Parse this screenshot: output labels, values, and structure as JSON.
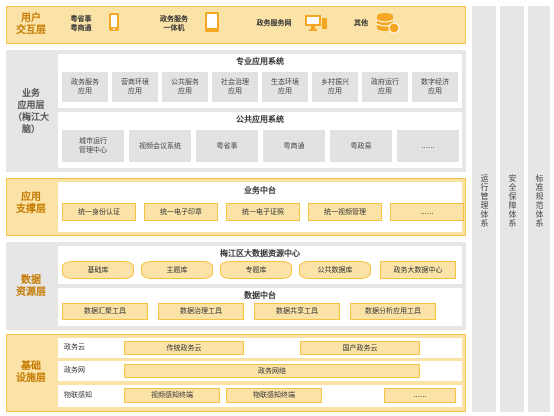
{
  "layers": {
    "user": "用户\n交互层",
    "app": "业务\n应用层\n（梅江大脑）",
    "support": "应用\n支撑层",
    "data": "数据\n资源层",
    "infra": "基础\n设施层"
  },
  "user_items": [
    {
      "label": "粤省事\n粤商通",
      "icon": "phone-icon"
    },
    {
      "label": "政务服务\n一体机",
      "icon": "tablet-icon"
    },
    {
      "label": "政务服务网",
      "icon": "monitor-icon"
    },
    {
      "label": "其他",
      "icon": "database-icon"
    }
  ],
  "app_special": {
    "title": "专业应用系统",
    "items": [
      "政务服务\n应用",
      "营商环境\n应用",
      "公共服务\n应用",
      "社会治理\n应用",
      "生态环境\n应用",
      "乡村振兴\n应用",
      "政府运行\n应用",
      "数字经济\n应用"
    ]
  },
  "app_public": {
    "title": "公共应用系统",
    "items": [
      "城市运行\n管理中心",
      "视频会议系统",
      "粤省事",
      "粤商通",
      "粤政易",
      "......"
    ]
  },
  "support": {
    "title": "业务中台",
    "items": [
      "统一身份认证",
      "统一电子印章",
      "统一电子证照",
      "统一视频管理",
      "......"
    ]
  },
  "data_center": {
    "title": "梅江区大数据资源中心",
    "dbs": [
      "基础库",
      "主题库",
      "专题库",
      "公共数据库"
    ],
    "extra": "政务大数据中心"
  },
  "data_platform": {
    "title": "数据中台",
    "items": [
      "数据汇聚工具",
      "数据治理工具",
      "数据共享工具",
      "数据分析应用工具"
    ]
  },
  "infra": {
    "rows": [
      {
        "label": "政务云",
        "items": [
          "传统政务云",
          "国产政务云"
        ]
      },
      {
        "label": "政务网",
        "items": [
          "政务网络"
        ]
      },
      {
        "label": "物联感知",
        "items": [
          "视频感知终端",
          "物联感知终端",
          "......"
        ]
      }
    ]
  },
  "side_columns": [
    "运行管理体系",
    "安全保障体系",
    "标准规范体系"
  ]
}
